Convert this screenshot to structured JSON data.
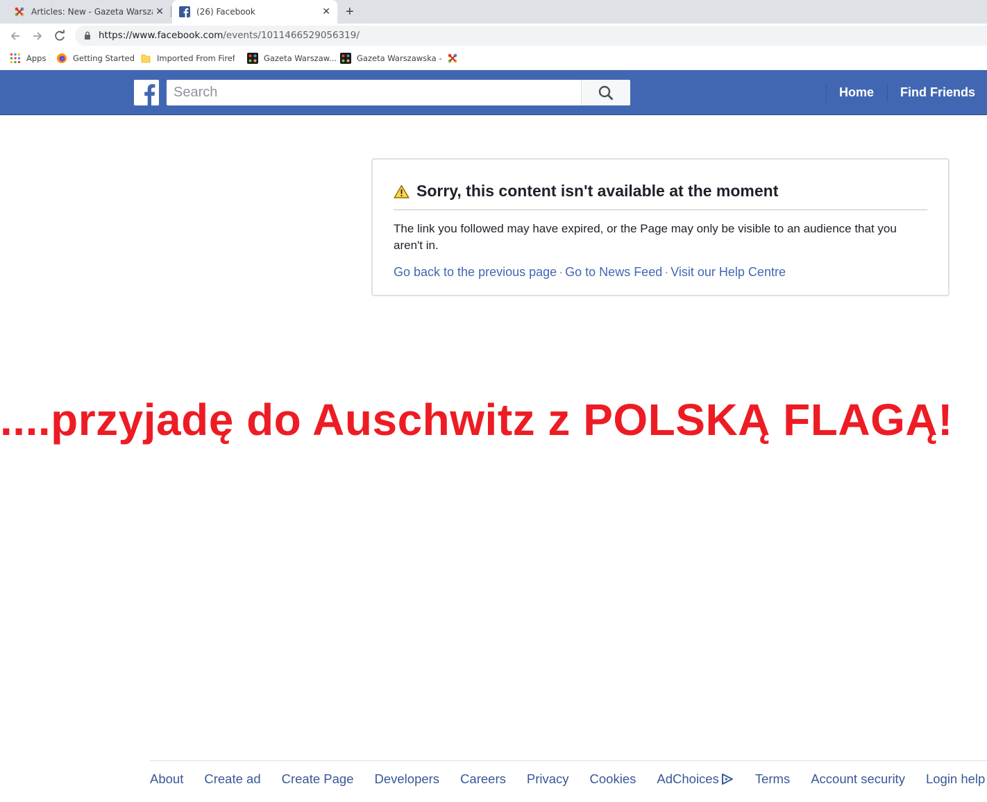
{
  "browser": {
    "tabs": [
      {
        "title": "Articles: New - Gazeta Warszawska",
        "active": false,
        "icon": "joomla-icon"
      },
      {
        "title": "(26) Facebook",
        "active": true,
        "icon": "facebook-icon"
      }
    ],
    "new_tab_glyph": "+",
    "close_glyph": "✕",
    "url": {
      "host": "https://www.facebook.com",
      "path": "/events/1011466529056319/"
    },
    "bookmarks": [
      {
        "label": "Apps",
        "icon": "apps-grid-icon"
      },
      {
        "label": "Getting Started",
        "icon": "firefox-icon"
      },
      {
        "label": "Imported From Firefox",
        "icon": "folder-icon"
      },
      {
        "label": "Gazeta Warszaw...",
        "icon": "joomla-icon"
      },
      {
        "label": "Gazeta Warszawska -",
        "icon": "joomla-icon"
      },
      {
        "label": "",
        "icon": "joomla-icon"
      }
    ]
  },
  "facebook": {
    "search_placeholder": "Search",
    "nav": {
      "home": "Home",
      "find_friends": "Find Friends"
    },
    "brand_color": "#4267b2"
  },
  "error": {
    "title": "Sorry, this content isn't available at the moment",
    "message": "The link you followed may have expired, or the Page may only be visible to an audience that you aren't in.",
    "links": [
      "Go back to the previous page",
      "Go to News Feed",
      "Visit our Help Centre"
    ],
    "separator": "·"
  },
  "overlay": {
    "text": "....przyjadę do Auschwitz z POLSKĄ FLAGĄ!",
    "color": "#ed1c24"
  },
  "footer": {
    "links": [
      "About",
      "Create ad",
      "Create Page",
      "Developers",
      "Careers",
      "Privacy",
      "Cookies",
      "AdChoices",
      "Terms",
      "Account security",
      "Login help"
    ]
  }
}
